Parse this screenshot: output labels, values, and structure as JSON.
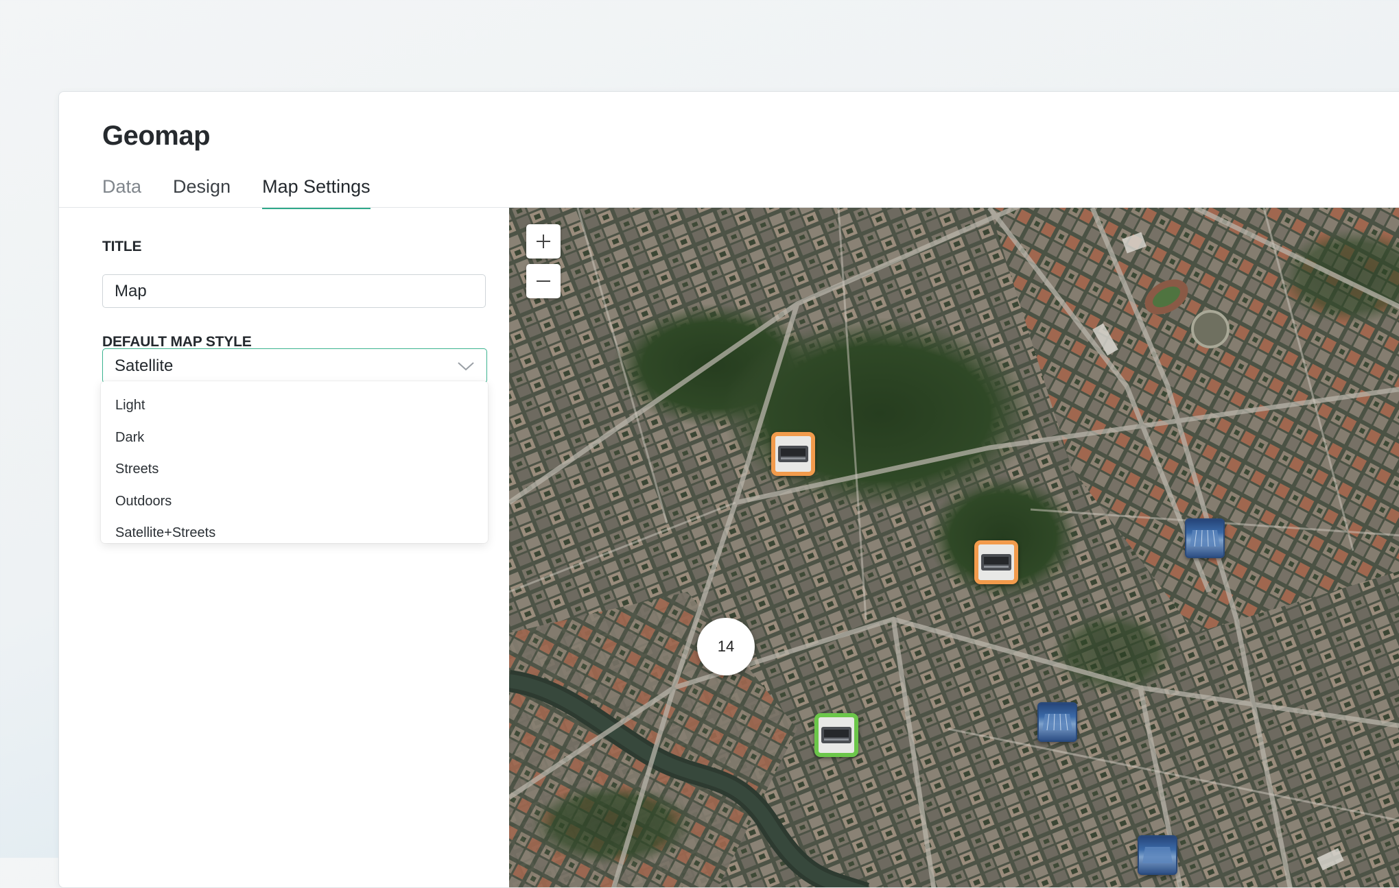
{
  "card": {
    "title": "Geomap"
  },
  "tabs": [
    {
      "label": "Data"
    },
    {
      "label": "Design"
    },
    {
      "label": "Map Settings"
    }
  ],
  "settings": {
    "title_label": "TITLE",
    "title_value": "Map",
    "style_label": "DEFAULT MAP STYLE",
    "style_value": "Satellite",
    "style_options": [
      "Light",
      "Dark",
      "Streets",
      "Outdoors",
      "Satellite+Streets"
    ]
  },
  "map": {
    "zoom_in_icon": "plus-icon",
    "zoom_out_icon": "minus-icon",
    "cluster_count": "14",
    "marker_colors": {
      "orange": "#f29b4c",
      "green": "#6cc64a",
      "blue": "#2a4a7a"
    }
  },
  "colors": {
    "accent": "#2fa88a"
  }
}
